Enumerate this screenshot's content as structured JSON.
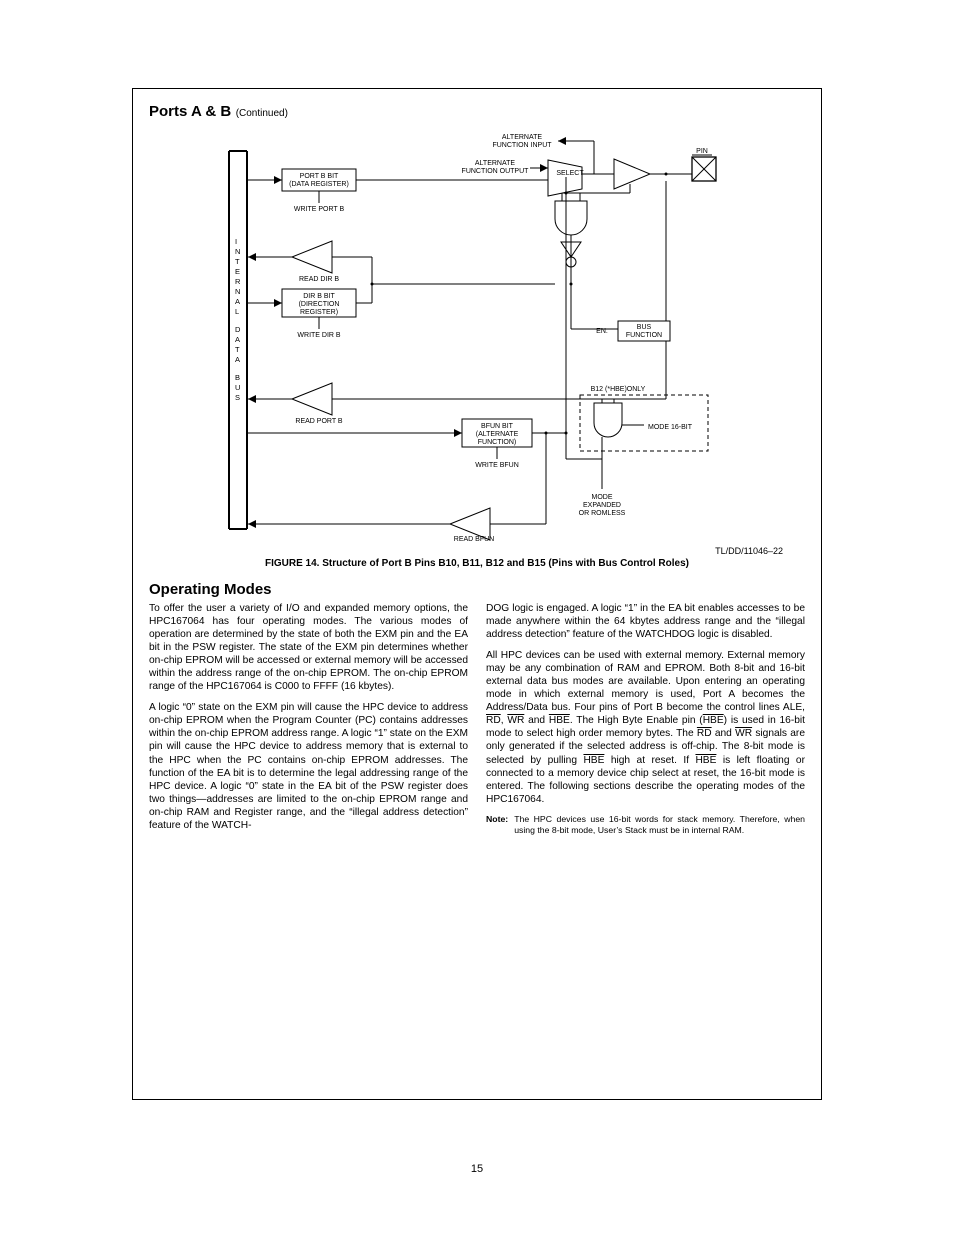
{
  "header": {
    "section_title": "Ports A & B",
    "continued": "(Continued)"
  },
  "figure": {
    "ref": "TL/DD/11046–22",
    "caption": "FIGURE 14. Structure of Port B Pins B10, B11, B12 and B15 (Pins with Bus Control Roles)",
    "labels": {
      "alt_in": "ALTERNATE\nFUNCTION INPUT",
      "alt_out": "ALTERNATE\nFUNCTION OUTPUT",
      "select": "SELECT",
      "pin": "PIN",
      "portb_bit": "PORT B BIT\n(DATA REGISTER)",
      "write_portb": "WRITE PORT B",
      "read_dirb": "READ DIR B",
      "dirb_bit": "DIR B BIT\n(DIRECTION\nREGISTER)",
      "write_dirb": "WRITE DIR B",
      "en": "EN.",
      "bus_fn": "BUS\nFUNCTION",
      "read_portb": "READ PORT B",
      "b12_only": "B12 (*HBE)ONLY",
      "bfun_bit": "BFUN BIT\n(ALTERNATE\nFUNCTION)",
      "write_bfun": "WRITE BFUN",
      "read_bfun": "READ BFUN",
      "mode16": "MODE 16-BIT",
      "mode_exp": "MODE\nEXPANDED\nOR ROMLESS",
      "bus_vert": "I N T E R N A L   D A T A   B U S"
    }
  },
  "section2": {
    "heading": "Operating Modes",
    "col1": {
      "p1": "To offer the user a variety of I/O and expanded memory options, the HPC167064 has four operating modes. The various modes of operation are determined by the state of both the EXM pin and the EA bit in the PSW register. The state of the EXM pin determines whether on-chip EPROM will be accessed or external memory will be accessed within the address range of the on-chip EPROM. The on-chip EPROM range of the HPC167064 is C000 to FFFF (16 kbytes).",
      "p2": "A logic “0” state on the EXM pin will cause the HPC device to address on-chip EPROM when the Program Counter (PC) contains addresses within the on-chip EPROM address range. A logic “1” state on the EXM pin will cause the HPC device to address memory that is external to the HPC when the PC contains on-chip EPROM addresses. The function of the EA bit is to determine the legal addressing range of the HPC device. A logic “0” state in the EA bit of the PSW register does two things—addresses are limited to the on-chip EPROM range and on-chip RAM and Register range, and the “illegal address detection” feature of the WATCH-"
    },
    "col2": {
      "p1": "DOG logic is engaged. A logic “1” in the EA bit enables accesses to be made anywhere within the 64 kbytes address range and the “illegal address detection” feature of the WATCHDOG logic is disabled.",
      "p2_pre": "All HPC devices can be used with external memory. External memory may be any combination of RAM and EPROM. Both 8-bit and 16-bit external data bus modes are available. Upon entering an operating mode in which external memory is used, Port A becomes the Address/Data bus. Four pins of Port B become the control lines ALE, ",
      "p2_rd": "RD",
      "p2_mid1": ", ",
      "p2_wr": "WR",
      "p2_mid2": " and ",
      "p2_hbe": "HBE",
      "p2_mid3": ". The High Byte Enable pin (",
      "p2_hbe2": "HBE",
      "p2_mid4": ") is used in 16-bit mode to select high order memory bytes. The ",
      "p2_rd2": "RD",
      "p2_mid5": " and ",
      "p2_wr2": "WR",
      "p2_mid6": " signals are only generated if the selected address is off-chip. The 8-bit mode is selected by pulling ",
      "p2_hbe3": "HBE",
      "p2_mid7": " high at reset. If ",
      "p2_hbe4": "HBE",
      "p2_mid8": " is left floating or connected to a memory device chip select at reset, the 16-bit mode is entered. The following sections describe the operating modes of the HPC167064.",
      "note_label": "Note:",
      "note_text": "The HPC devices use 16-bit words for stack memory. Therefore, when using the 8-bit mode, User’s Stack must be in internal RAM."
    }
  },
  "page_number": "15"
}
